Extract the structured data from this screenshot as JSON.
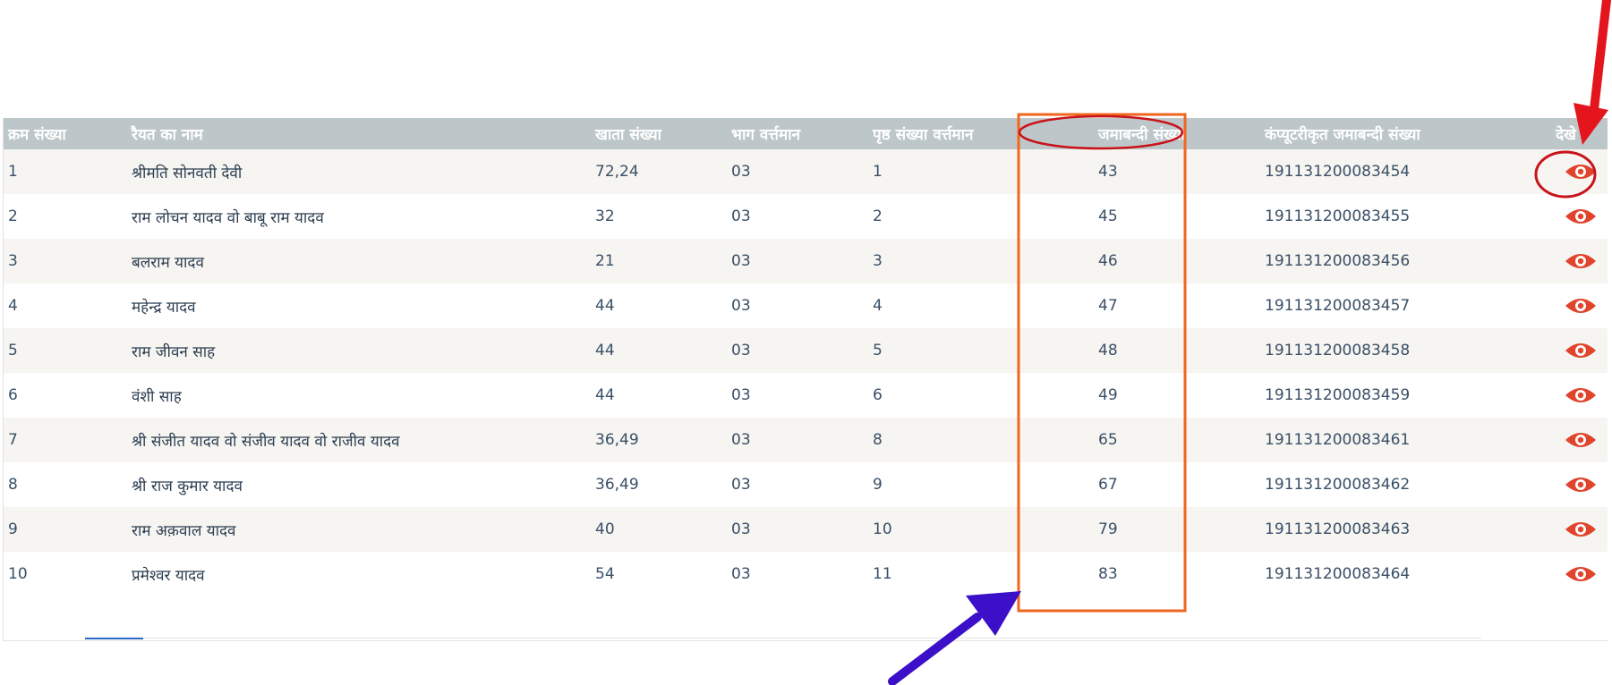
{
  "table": {
    "headers": [
      "क्रम संख्या",
      "रैयत का नाम",
      "खाता संख्या",
      "भाग वर्त्तमान",
      "पृष्ठ संख्या वर्त्तमान",
      "जमाबन्दी संख्या",
      "कंप्यूटरीकृत जमाबन्दी संख्या",
      "देखे"
    ],
    "rows": [
      {
        "sno": "1",
        "name": "श्रीमति सोनवती देवी",
        "khata": "72,24",
        "bhag": "03",
        "page": "1",
        "jamabandi": "43",
        "computerized": "191131200083454"
      },
      {
        "sno": "2",
        "name": "राम लोचन यादव वो बाबू राम यादव",
        "khata": "32",
        "bhag": "03",
        "page": "2",
        "jamabandi": "45",
        "computerized": "191131200083455"
      },
      {
        "sno": "3",
        "name": "बलराम यादव",
        "khata": "21",
        "bhag": "03",
        "page": "3",
        "jamabandi": "46",
        "computerized": "191131200083456"
      },
      {
        "sno": "4",
        "name": "महेन्द्र यादव",
        "khata": "44",
        "bhag": "03",
        "page": "4",
        "jamabandi": "47",
        "computerized": "191131200083457"
      },
      {
        "sno": "5",
        "name": "राम जीवन साह",
        "khata": "44",
        "bhag": "03",
        "page": "5",
        "jamabandi": "48",
        "computerized": "191131200083458"
      },
      {
        "sno": "6",
        "name": "वंशी साह",
        "khata": "44",
        "bhag": "03",
        "page": "6",
        "jamabandi": "49",
        "computerized": "191131200083459"
      },
      {
        "sno": "7",
        "name": "श्री संजीत यादव वो संजीव यादव वो राजीव यादव",
        "khata": "36,49",
        "bhag": "03",
        "page": "8",
        "jamabandi": "65",
        "computerized": "191131200083461"
      },
      {
        "sno": "8",
        "name": "श्री राज कुमार यादव",
        "khata": "36,49",
        "bhag": "03",
        "page": "9",
        "jamabandi": "67",
        "computerized": "191131200083462"
      },
      {
        "sno": "9",
        "name": "राम अक़वाल यादव",
        "khata": "40",
        "bhag": "03",
        "page": "10",
        "jamabandi": "79",
        "computerized": "191131200083463"
      },
      {
        "sno": "10",
        "name": "प्रमेश्वर यादव",
        "khata": "54",
        "bhag": "03",
        "page": "11",
        "jamabandi": "83",
        "computerized": "191131200083464"
      }
    ]
  },
  "icons": {
    "view": "eye-icon"
  },
  "colors": {
    "header_bg": "#bdc7c9",
    "eye": "#e0442c",
    "highlight_box": "#f0661e",
    "annotation_red": "#e4151c",
    "annotation_blue": "#3b10c8",
    "pager_active": "#2a66c4"
  }
}
